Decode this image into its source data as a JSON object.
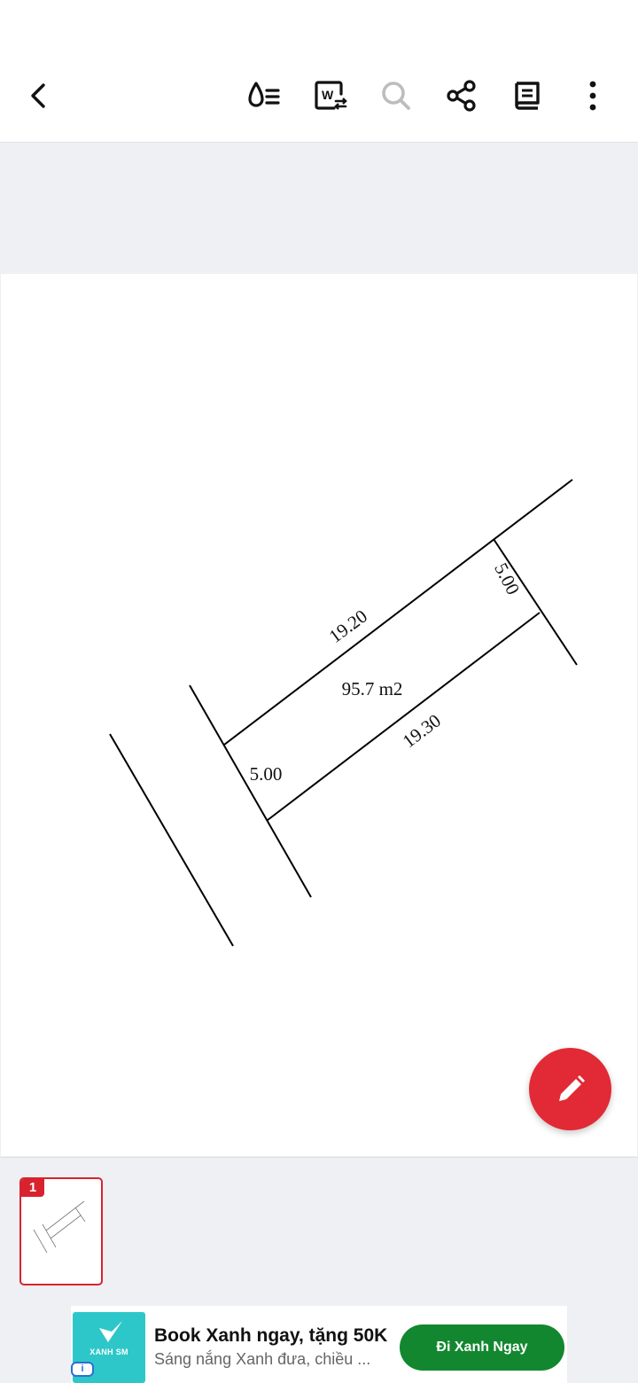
{
  "toolbar": {
    "icons": [
      "back-icon",
      "ink-drop-menu-icon",
      "word-convert-icon",
      "search-icon",
      "share-icon",
      "book-icon",
      "more-vertical-icon"
    ],
    "search_disabled": true
  },
  "document": {
    "labels": {
      "top_length": "19.20",
      "bottom_length": "19.30",
      "right_width": "5.00",
      "left_width": "5.00",
      "area": "95.7 m2"
    }
  },
  "thumbnails": [
    {
      "page_number": "1",
      "selected": true
    }
  ],
  "ad": {
    "logo_text": "XANH SM",
    "info_label": "i",
    "title": "Book Xanh ngay, tặng 50K",
    "subtitle": "Sáng nắng Xanh đưa, chiều ...",
    "cta_label": "Đi Xanh Ngay"
  },
  "colors": {
    "accent_red": "#e12a35",
    "ad_green": "#12872f",
    "ad_teal": "#2ec7c9"
  }
}
